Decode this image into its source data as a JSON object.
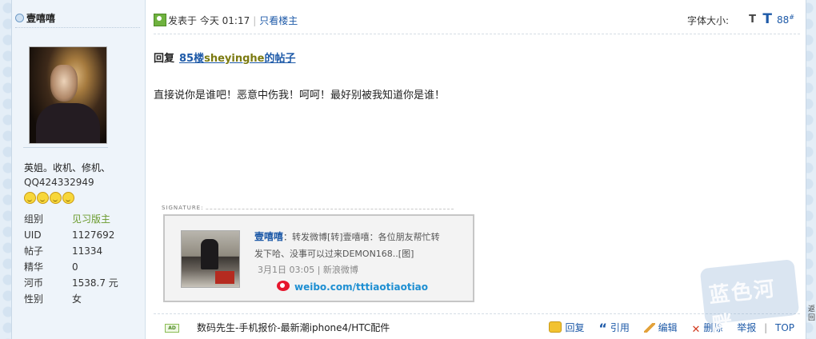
{
  "user": {
    "name": "壹嘻嘻",
    "title_line": "英姐。收机、修机、",
    "qq": "QQ424332949",
    "stats": [
      {
        "key": "组别",
        "value": "见习版主"
      },
      {
        "key": "UID",
        "value": "1127692"
      },
      {
        "key": "帖子",
        "value": "11334"
      },
      {
        "key": "精华",
        "value": "0"
      },
      {
        "key": "河币",
        "value": "1538.7 元"
      },
      {
        "key": "性别",
        "value": "女"
      }
    ]
  },
  "post": {
    "posted_label": "发表于",
    "posted_time": "今天  01:17",
    "only_author": "只看楼主",
    "font_size_label": "字体大小:",
    "font_small": "T",
    "font_big": "T",
    "floor": "88",
    "floor_mark": "#",
    "reply_label": "回复",
    "reply_link_pre": "85楼",
    "reply_link_user": "sheyinghe",
    "reply_link_post": "的帖子",
    "content": "直接说你是谁吧！恶意中伤我！呵呵！最好别被我知道你是谁！"
  },
  "signature": {
    "label": "SIGNATURE:",
    "name": "壹嘻嘻",
    "text": "：转发微博[转]壹嘻嘻：各位朋友帮忙转发下哈、没事可以过来DEMON168..[图]",
    "date": "3月1日 03:05 | 新浪微博",
    "link": "weibo.com/tttiaotiaotiao"
  },
  "footer": {
    "ad_badge": "AD",
    "ad_text": "数码先生-手机报价-最新潮iphone4/HTC配件",
    "reply": "回复",
    "quote": "引用",
    "edit": "编辑",
    "delete": "删除",
    "report": "举报",
    "top": "TOP"
  },
  "watermark": "蓝色河畔",
  "edge_text": "返回"
}
